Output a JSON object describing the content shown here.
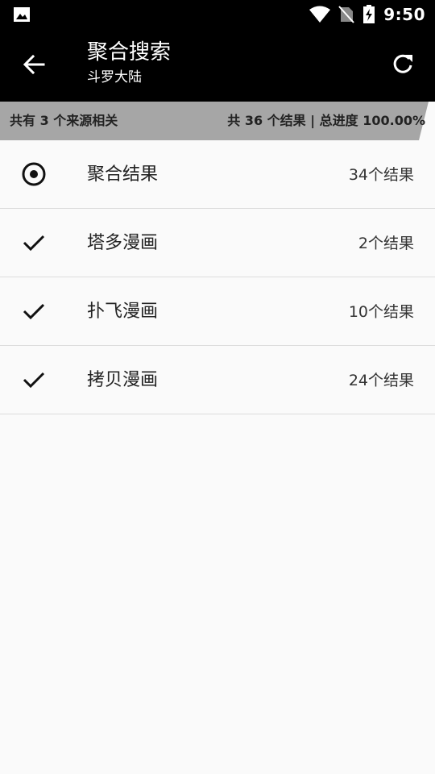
{
  "status_bar": {
    "time": "9:50",
    "icons": [
      "image-icon",
      "wifi-icon",
      "no-sim-icon",
      "battery-charging-icon"
    ]
  },
  "app_bar": {
    "title": "聚合搜索",
    "subtitle": "斗罗大陆",
    "back_icon": "arrow-back-icon",
    "refresh_icon": "refresh-icon"
  },
  "summary": {
    "sources_text": "共有 3 个来源相关",
    "progress_text": "共 36 个结果 | 总进度 100.00%",
    "progress": 1.0
  },
  "sources": [
    {
      "label": "聚合结果",
      "count": "34个结果",
      "icon": "radio-selected-icon"
    },
    {
      "label": "塔多漫画",
      "count": "2个结果",
      "icon": "check-icon"
    },
    {
      "label": "扑飞漫画",
      "count": "10个结果",
      "icon": "check-icon"
    },
    {
      "label": "拷贝漫画",
      "count": "24个结果",
      "icon": "check-icon"
    }
  ],
  "colors": {
    "bar_background": "#000000",
    "progress_fill": "#a6a6a6",
    "page_background": "#fafafa"
  }
}
